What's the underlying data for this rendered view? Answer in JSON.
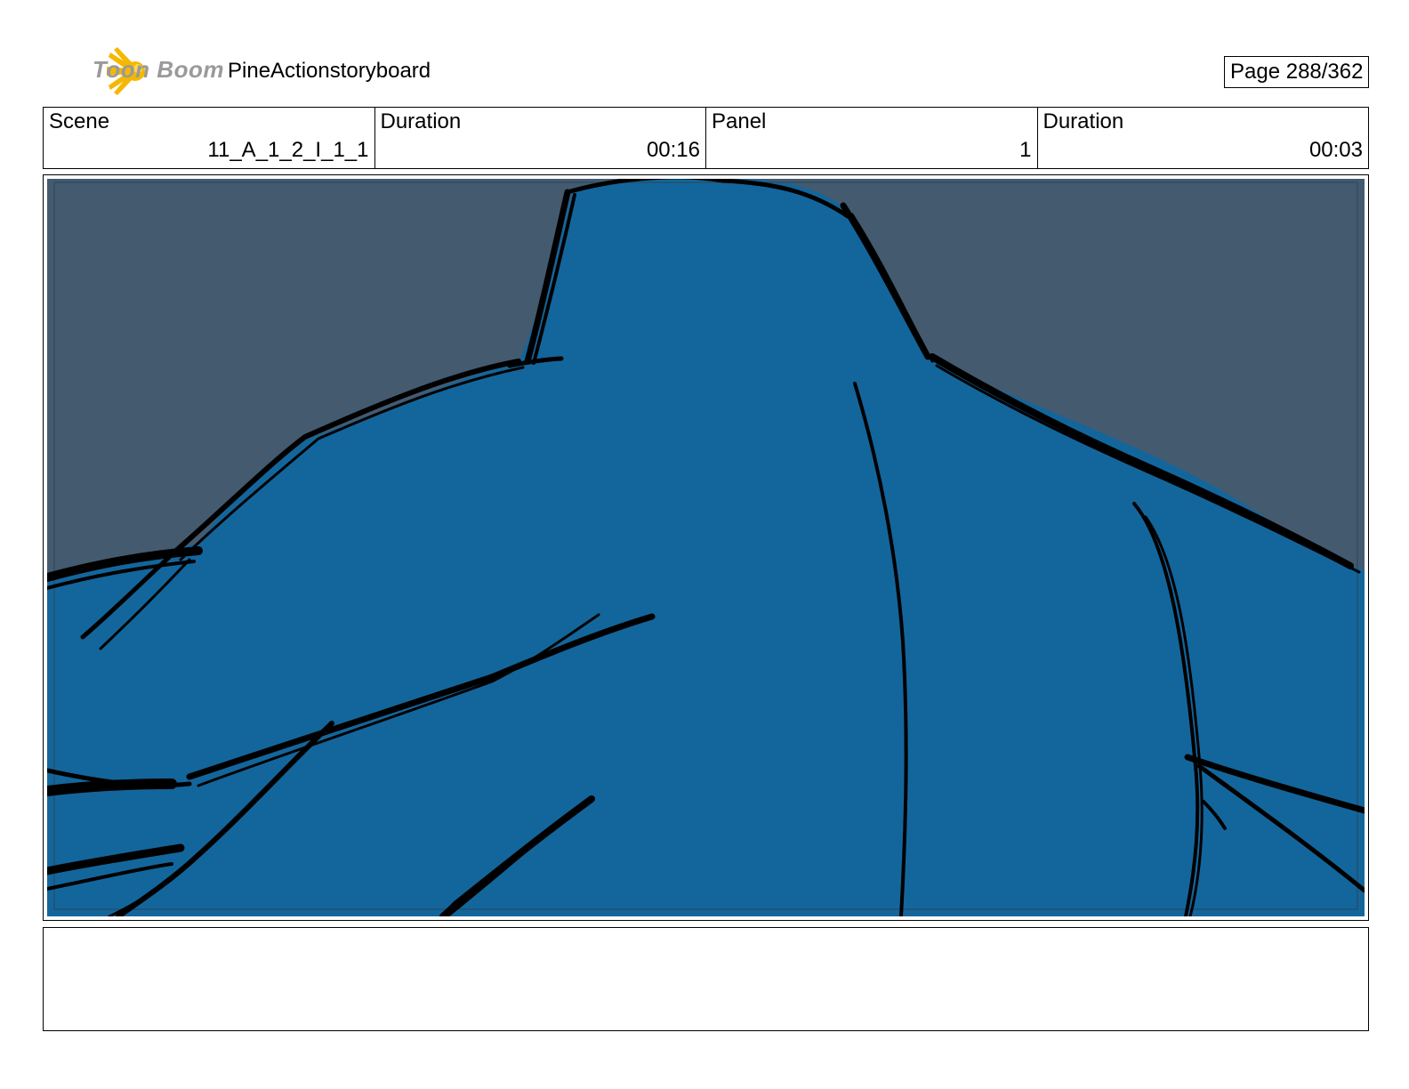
{
  "header": {
    "logo_text": "Toon Boom",
    "project_title": "PineActionstoryboard",
    "page_label": "Page 288/362"
  },
  "info": {
    "scene_label": "Scene",
    "scene_value": "11_A_1_2_I_1_1",
    "scene_duration_label": "Duration",
    "scene_duration_value": "00:16",
    "panel_label": "Panel",
    "panel_value": "1",
    "panel_duration_label": "Duration",
    "panel_duration_value": "00:03"
  },
  "panel_image": {
    "description_name": "storyboard-sketch",
    "colors": {
      "sky": "#445a6f",
      "figure": "#13669c",
      "ink": "#000000"
    }
  },
  "notes": {
    "text": ""
  }
}
